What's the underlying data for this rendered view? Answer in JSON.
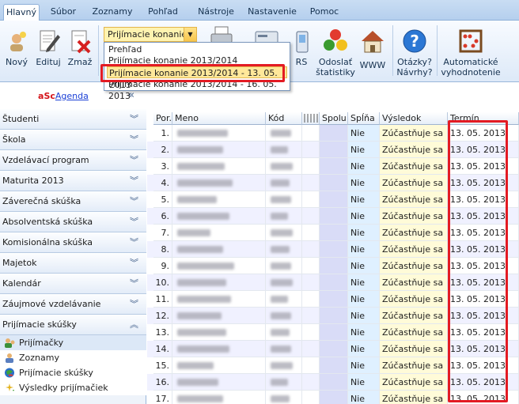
{
  "tabs": [
    "Hlavný",
    "Súbor",
    "Zoznamy",
    "Pohľad",
    "Nástroje",
    "Nastavenie",
    "Pomoc"
  ],
  "ribbon": {
    "new": "Nový",
    "edit": "Edituj",
    "delete": "Zmaž",
    "combo_value": "Prijímacie konanie",
    "rs_label": "RS",
    "send_stats": [
      "Odoslať",
      "štatistiky"
    ],
    "www": "WWW",
    "questions": [
      "Otázky?",
      "Návrhy?"
    ],
    "auto_eval": [
      "Automatické",
      "vyhodnotenie"
    ]
  },
  "dropdown": {
    "items": [
      "Prehľad",
      "Prijímacie konanie 2013/2014",
      "Prijímacie konanie 2013/2014 - 13. 05. 2013",
      "Prijímacie konanie 2013/2014 - 16. 05. 2013"
    ],
    "highlighted_index": 2
  },
  "sidebar": {
    "brand_a": "a",
    "brand_sc": "Sc",
    "brand_rest": "Agenda",
    "collapse_icon": "«",
    "sections": [
      "Študenti",
      "Škola",
      "Vzdelávací program",
      "Maturita 2013",
      "Záverečná skúška",
      "Absolventská skúška",
      "Komisionálna skúška",
      "Majetok",
      "Kalendár",
      "Záujmové vzdelávanie",
      "Prijímacie skúšky"
    ],
    "subitems": [
      "Prijímačky",
      "Zoznamy",
      "Prijímacie skúšky",
      "Výsledky prijímačiek"
    ],
    "selected_subitem": 0
  },
  "grid": {
    "columns": [
      "Por.",
      "Meno",
      "Kód",
      "Spolu",
      "Spĺňa",
      "Výsledok",
      "Termín"
    ],
    "rows": [
      {
        "por": "1.",
        "spln": "Nie",
        "vysledok": "Zúčastňuje sa",
        "termin": "13. 05. 2013"
      },
      {
        "por": "2.",
        "spln": "Nie",
        "vysledok": "Zúčastňuje sa",
        "termin": "13. 05. 2013"
      },
      {
        "por": "3.",
        "spln": "Nie",
        "vysledok": "Zúčastňuje sa",
        "termin": "13. 05. 2013"
      },
      {
        "por": "4.",
        "spln": "Nie",
        "vysledok": "Zúčastňuje sa",
        "termin": "13. 05. 2013"
      },
      {
        "por": "5.",
        "spln": "Nie",
        "vysledok": "Zúčastňuje sa",
        "termin": "13. 05. 2013"
      },
      {
        "por": "6.",
        "spln": "Nie",
        "vysledok": "Zúčastňuje sa",
        "termin": "13. 05. 2013"
      },
      {
        "por": "7.",
        "spln": "Nie",
        "vysledok": "Zúčastňuje sa",
        "termin": "13. 05. 2013"
      },
      {
        "por": "8.",
        "spln": "Nie",
        "vysledok": "Zúčastňuje sa",
        "termin": "13. 05. 2013"
      },
      {
        "por": "9.",
        "spln": "Nie",
        "vysledok": "Zúčastňuje sa",
        "termin": "13. 05. 2013"
      },
      {
        "por": "10.",
        "spln": "Nie",
        "vysledok": "Zúčastňuje sa",
        "termin": "13. 05. 2013"
      },
      {
        "por": "11.",
        "spln": "Nie",
        "vysledok": "Zúčastňuje sa",
        "termin": "13. 05. 2013"
      },
      {
        "por": "12.",
        "spln": "Nie",
        "vysledok": "Zúčastňuje sa",
        "termin": "13. 05. 2013"
      },
      {
        "por": "13.",
        "spln": "Nie",
        "vysledok": "Zúčastňuje sa",
        "termin": "13. 05. 2013"
      },
      {
        "por": "14.",
        "spln": "Nie",
        "vysledok": "Zúčastňuje sa",
        "termin": "13. 05. 2013"
      },
      {
        "por": "15.",
        "spln": "Nie",
        "vysledok": "Zúčastňuje sa",
        "termin": "13. 05. 2013"
      },
      {
        "por": "16.",
        "spln": "Nie",
        "vysledok": "Zúčastňuje sa",
        "termin": "13. 05. 2013"
      },
      {
        "por": "17.",
        "spln": "Nie",
        "vysledok": "Zúčastňuje sa",
        "termin": "13. 05. 2013"
      }
    ]
  },
  "colors": {
    "highlight_red": "#e31b23",
    "spolu_bg": "#d9dcf7",
    "spln_bg": "#dff0ff",
    "vysledok_bg": "#fffbd8",
    "row_alt": "#f0f1ff"
  }
}
